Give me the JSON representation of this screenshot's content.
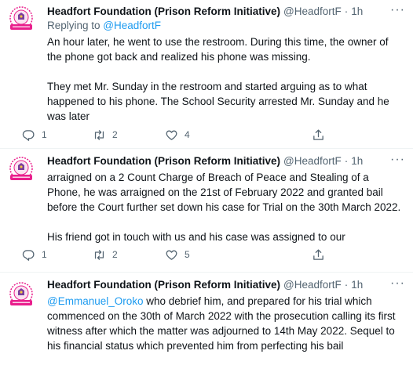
{
  "tweets": [
    {
      "name": "Headfort Foundation (Prison Reform Initiative)",
      "handle": "@HeadfortF",
      "dot": "·",
      "time": "1h",
      "more": "···",
      "reply_prefix": "Replying to ",
      "reply_to": "@HeadfortF",
      "paragraphs": [
        "An hour later, he went to use the restroom. During this time, the owner of the phone got back and realized his phone was missing.",
        "They met Mr. Sunday in the restroom and started arguing as to what happened to his phone. The School Security arrested Mr. Sunday and he was later"
      ],
      "replies": "1",
      "retweets": "2",
      "likes": "4"
    },
    {
      "name": "Headfort Foundation (Prison Reform Initiative)",
      "handle": "@HeadfortF",
      "dot": "·",
      "time": "1h",
      "more": "···",
      "paragraphs": [
        "arraigned on a 2 Count Charge of Breach of Peace and Stealing of a Phone, he was arraigned on the 21st of February 2022 and granted bail before the Court further set down his case for Trial on the 30th March 2022.",
        "His friend got in touch with us and his case was assigned to our"
      ],
      "replies": "1",
      "retweets": "2",
      "likes": "5"
    },
    {
      "name": "Headfort Foundation (Prison Reform Initiative)",
      "handle": "@HeadfortF",
      "dot": "·",
      "time": "1h",
      "more": "···",
      "mention": "@Emmanuel_Oroko",
      "text_after_mention": " who debrief him, and prepared for his trial which commenced on the 30th of March 2022 with the prosecution calling its first witness after which the matter was adjourned to 14th May 2022. Sequel to his financial status which prevented him from perfecting his bail"
    }
  ],
  "colors": {
    "text": "#0f1419",
    "secondary": "#536471",
    "link": "#1d9bf0",
    "avatar_pink": "#e91e8c"
  },
  "icons": [
    "avatar-logo",
    "more-icon",
    "reply-icon",
    "retweet-icon",
    "like-icon",
    "share-icon"
  ]
}
